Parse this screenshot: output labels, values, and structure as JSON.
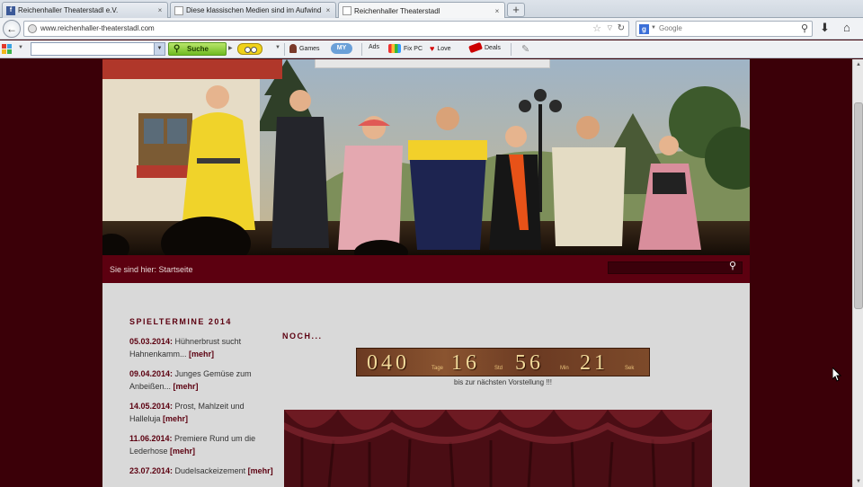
{
  "browser": {
    "tabs": [
      {
        "title": "Reichenhaller Theaterstadl e.V.",
        "favicon": "facebook-icon",
        "active": false
      },
      {
        "title": "Diese klassischen Medien sind im Aufwind...",
        "favicon": "page-icon",
        "active": false
      },
      {
        "title": "Reichenhaller Theaterstadl",
        "favicon": "page-icon",
        "active": true
      }
    ],
    "tab_close": "×",
    "new_tab": "+",
    "url": "www.reichenhaller-theaterstadl.com",
    "search_placeholder": "Google",
    "search_engine_letter": "g"
  },
  "toolbar": {
    "suche_label": "Suche",
    "games_label": "Games",
    "ads_label": "Ads",
    "fixpc_label": "Fix PC",
    "love_label": "Love",
    "deals_label": "Deals",
    "my_label": "MY"
  },
  "site": {
    "breadcrumb": "Sie sind hier: Startseite",
    "sidebar_title": "SPIELTERMINE 2014",
    "events": [
      {
        "date": "05.03.2014:",
        "text": " Hühnerbrust sucht Hahnenkamm... ",
        "more": "[mehr]"
      },
      {
        "date": "09.04.2014:",
        "text": " Junges Gemüse zum Anbeißen... ",
        "more": "[mehr]"
      },
      {
        "date": "14.05.2014:",
        "text": " Prost, Mahlzeit und Halleluja ",
        "more": "[mehr]"
      },
      {
        "date": "11.06.2014:",
        "text": " Premiere Rund um die Lederhose ",
        "more": "[mehr]"
      },
      {
        "date": "23.07.2014:",
        "text": " Dudelsackeizement ",
        "more": "[mehr]"
      }
    ],
    "countdown_heading": "NOCH...",
    "countdown": {
      "days": "040",
      "days_unit": "Tage",
      "hours": "16",
      "hours_unit": "Std",
      "minutes": "56",
      "minutes_unit": "Min",
      "seconds": "21",
      "seconds_unit": "Sek"
    },
    "countdown_caption": "bis zur nächsten Vorstellung !!!"
  }
}
